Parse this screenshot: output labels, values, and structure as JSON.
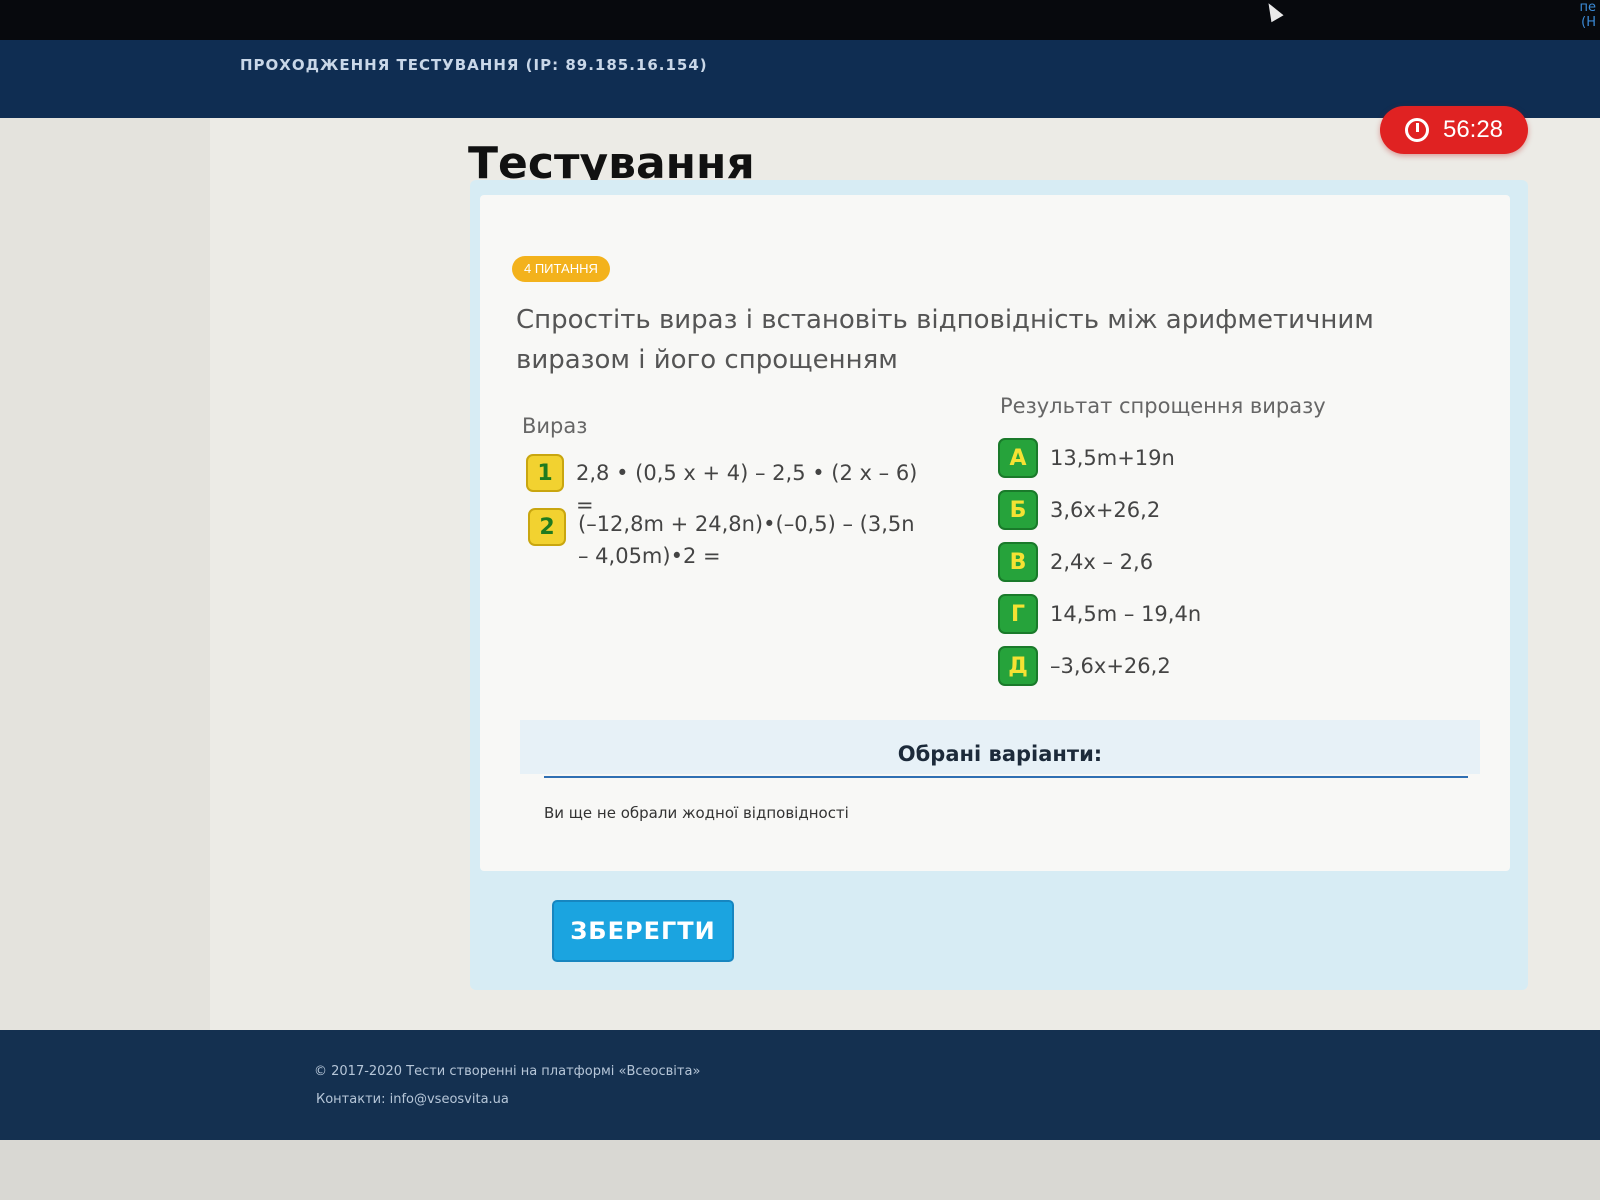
{
  "header": {
    "title": "ПРОХОДЖЕННЯ ТЕСТУВАННЯ (IP: 89.185.16.154)",
    "corner": "пе\n(Н"
  },
  "page": {
    "title": "Тестування"
  },
  "timer": {
    "value": "56:28",
    "icon": "stopwatch-icon",
    "color": "#e02222"
  },
  "question": {
    "badge": "4 ПИТАННЯ",
    "text": "Спростіть вираз і встановіть відповідність між арифметичним виразом і його спрощенням",
    "left_heading": "Вираз",
    "right_heading": "Результат спрощення виразу",
    "expressions": [
      {
        "num": "1",
        "text": "2,8 • (0,5 x + 4) – 2,5 • (2 x – 6) ="
      },
      {
        "num": "2",
        "text": "(–12,8m + 24,8n)•(–0,5) – (3,5n – 4,05m)•2 ="
      }
    ],
    "answers": [
      {
        "letter": "А",
        "text": "13,5m+19n"
      },
      {
        "letter": "Б",
        "text": "3,6x+26,2"
      },
      {
        "letter": "В",
        "text": "2,4x – 2,6"
      },
      {
        "letter": "Г",
        "text": "14,5m – 19,4n"
      },
      {
        "letter": "Д",
        "text": "–3,6x+26,2"
      }
    ]
  },
  "selected": {
    "title": "Обрані варіанти:",
    "empty_text": "Ви ще не обрали жодної відповідності"
  },
  "actions": {
    "save_label": "ЗБЕРЕГТИ"
  },
  "footer": {
    "copyright": "© 2017-2020 Тести створенні на платформі «Всеосвіта»",
    "contact_label": "Контакти: ",
    "contact_email": "info@vseosvita.ua"
  },
  "colors": {
    "header_bg": "#0f2d52",
    "accent_blue": "#1ba4e0",
    "badge_yellow": "#f3b21c",
    "answer_green": "#26a33b",
    "expr_yellow": "#f2d230",
    "footer_bg": "#143050"
  }
}
